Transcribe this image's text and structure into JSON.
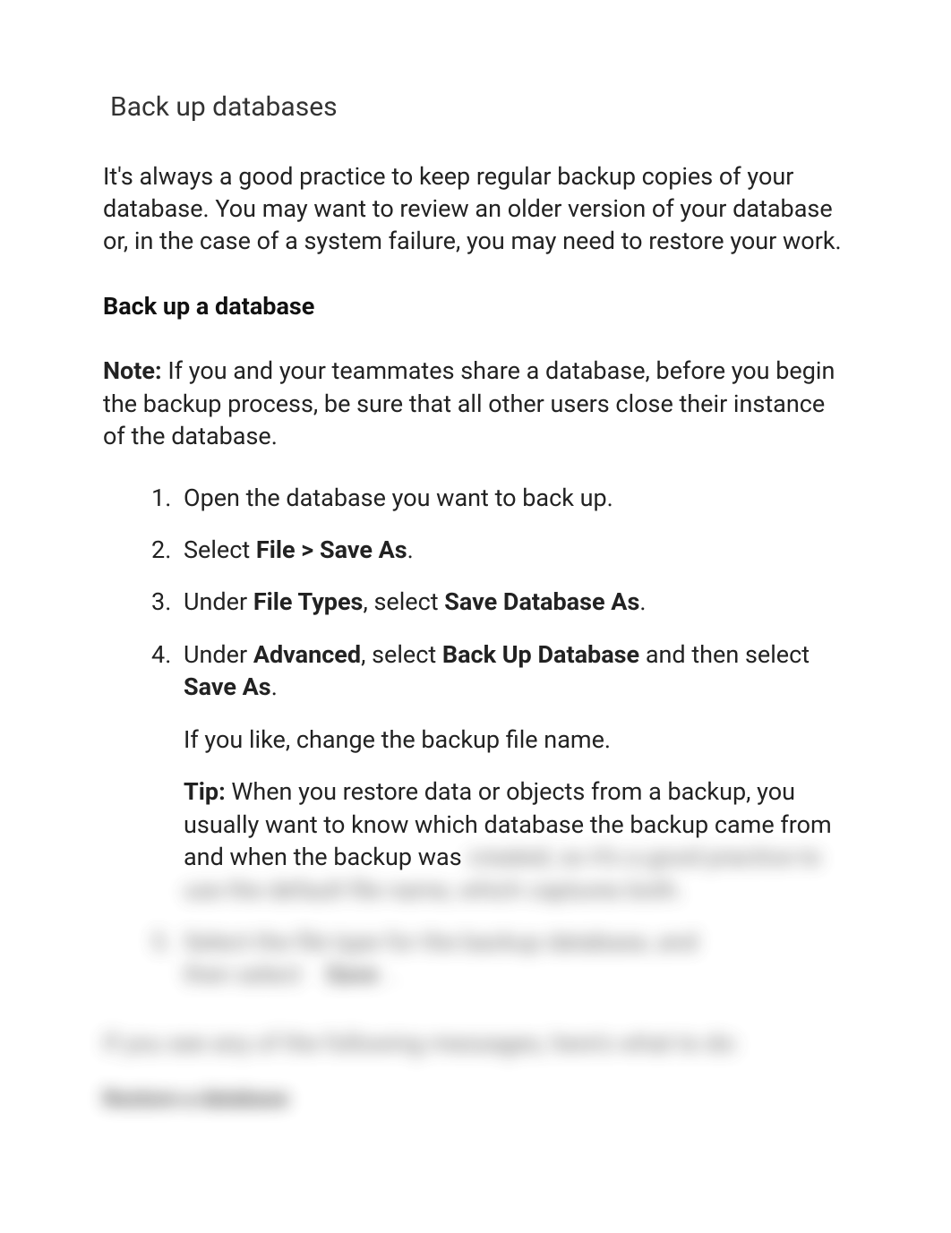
{
  "title": "Back up databases",
  "intro": "It's always a good practice to keep regular backup copies of your database. You may want to review an older version of your database or, in the case of a system failure, you may need to restore your work.",
  "section_heading": "Back up a database",
  "note": {
    "label": "Note:",
    "text": " If you and your teammates share a database, before you begin the backup process, be sure that all other users close their instance of the database."
  },
  "steps": {
    "s1": "Open the database you want to back up.",
    "s2": {
      "prefix": "Select ",
      "bold": "File > Save As",
      "suffix": "."
    },
    "s3": {
      "p1": "Under ",
      "b1": "File Types",
      "p2": ", select ",
      "b2": "Save Database As",
      "p3": "."
    },
    "s4": {
      "p1": "Under ",
      "b1": "Advanced",
      "p2": ", select ",
      "b2": "Back Up Database",
      "p3": " and then select ",
      "b3": "Save As",
      "p4": ".",
      "sub1": "If you like, change the backup file name.",
      "tip_label": "Tip:",
      "tip_visible": " When you restore data or objects from a backup, you usually want to know which database the backup came from and when the backup was ",
      "tip_blurred": "created, so it's a good practice to use the default file name, which captures both."
    },
    "s5": {
      "line1": "Select the file type for the backup database, and",
      "line2_a": "then select",
      "line2_b": "Save",
      "line2_c": "."
    }
  },
  "after": {
    "msg": "If you see any of the following messages, here's what to do:",
    "subheading": "Restore a database"
  }
}
